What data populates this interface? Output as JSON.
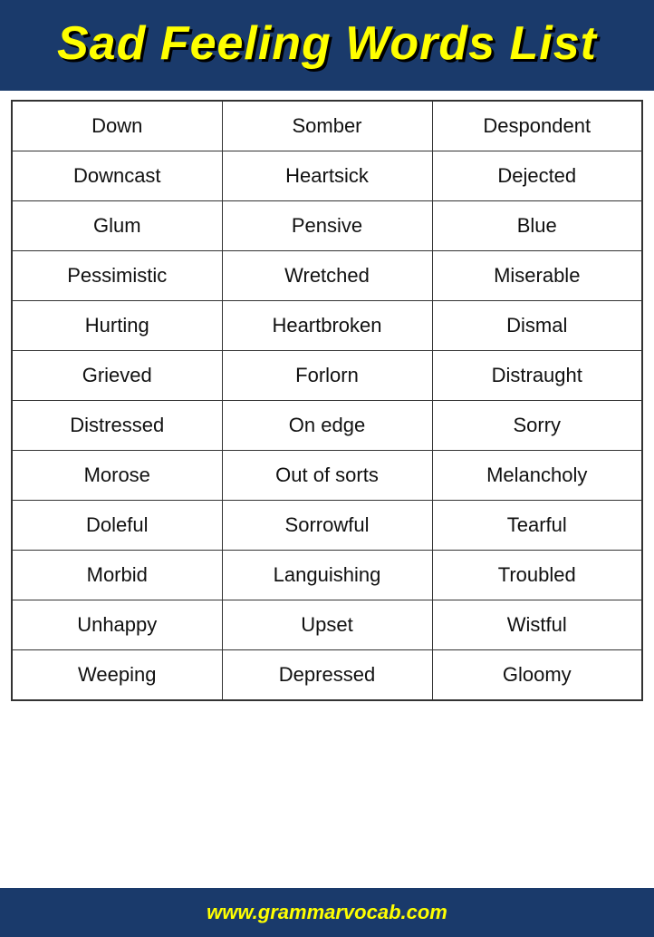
{
  "header": {
    "title": "Sad Feeling Words List"
  },
  "table": {
    "rows": [
      [
        "Down",
        "Somber",
        "Despondent"
      ],
      [
        "Downcast",
        "Heartsick",
        "Dejected"
      ],
      [
        "Glum",
        "Pensive",
        "Blue"
      ],
      [
        "Pessimistic",
        "Wretched",
        "Miserable"
      ],
      [
        "Hurting",
        "Heartbroken",
        "Dismal"
      ],
      [
        "Grieved",
        "Forlorn",
        "Distraught"
      ],
      [
        "Distressed",
        "On edge",
        "Sorry"
      ],
      [
        "Morose",
        "Out of sorts",
        "Melancholy"
      ],
      [
        "Doleful",
        "Sorrowful",
        "Tearful"
      ],
      [
        "Morbid",
        "Languishing",
        "Troubled"
      ],
      [
        "Unhappy",
        "Upset",
        "Wistful"
      ],
      [
        "Weeping",
        "Depressed",
        "Gloomy"
      ]
    ]
  },
  "footer": {
    "url": "www.grammarvocab.com"
  }
}
